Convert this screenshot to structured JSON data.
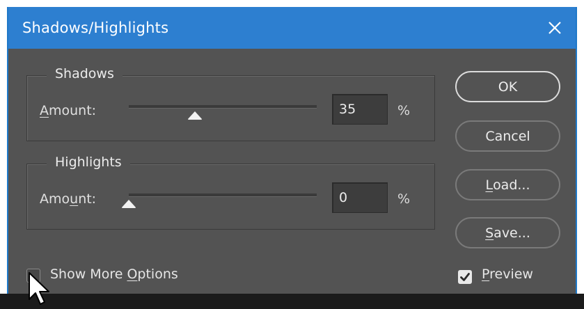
{
  "dialog": {
    "title": "Shadows/Highlights",
    "close_icon": "close-icon"
  },
  "shadows": {
    "legend": "Shadows",
    "amount_label_pre": "",
    "amount_label_u": "A",
    "amount_label_post": "mount:",
    "amount_value": "35",
    "unit": "%",
    "slider_fraction": 0.35
  },
  "highlights": {
    "legend": "Highlights",
    "amount_label_pre": "Amo",
    "amount_label_u": "u",
    "amount_label_post": "nt:",
    "amount_value": "0",
    "unit": "%",
    "slider_fraction": 0.0
  },
  "buttons": {
    "ok": "OK",
    "cancel": "Cancel",
    "load_u": "L",
    "load_rest": "oad...",
    "save_u": "S",
    "save_rest": "ave..."
  },
  "options": {
    "show_more_pre": "Show More ",
    "show_more_u": "O",
    "show_more_post": "ptions",
    "show_more_checked": false,
    "preview_u": "P",
    "preview_rest": "review",
    "preview_checked": true
  },
  "colors": {
    "titlebar": "#2d7fd0",
    "dialog_bg": "#535353",
    "text": "#e6e6e6"
  }
}
